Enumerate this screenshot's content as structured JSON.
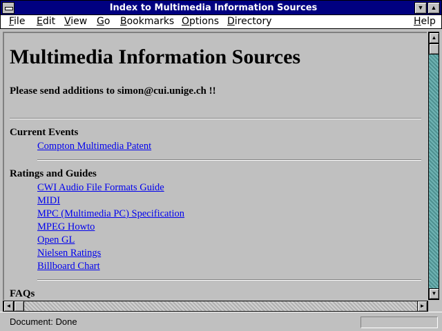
{
  "window": {
    "title": "Index to Multimedia Information Sources"
  },
  "menu": {
    "items": [
      "File",
      "Edit",
      "View",
      "Go",
      "Bookmarks",
      "Options",
      "Directory"
    ],
    "help": "Help"
  },
  "page": {
    "heading": "Multimedia Information Sources",
    "subtitle": "Please send additions to simon@cui.unige.ch !!",
    "sections": [
      {
        "title": "Current Events",
        "links": [
          "Compton Multimedia Patent"
        ]
      },
      {
        "title": "Ratings and Guides",
        "links": [
          "CWI Audio File Formats Guide",
          "MIDI",
          "MPC (Multimedia PC) Specification",
          "MPEG Howto",
          "Open GL",
          "Nielsen Ratings",
          "Billboard Chart"
        ]
      },
      {
        "title": "FAQs",
        "links": []
      }
    ]
  },
  "status": {
    "text": "Document: Done"
  },
  "icons": {
    "system_menu": "system-menu-icon",
    "minimize": "▼",
    "maximize": "▲",
    "scroll_up": "▲",
    "scroll_down": "▼",
    "scroll_left": "◄",
    "scroll_right": "►"
  },
  "colors": {
    "titlebar": "#000080",
    "link": "#0000ee",
    "background": "#c0c0c0"
  }
}
